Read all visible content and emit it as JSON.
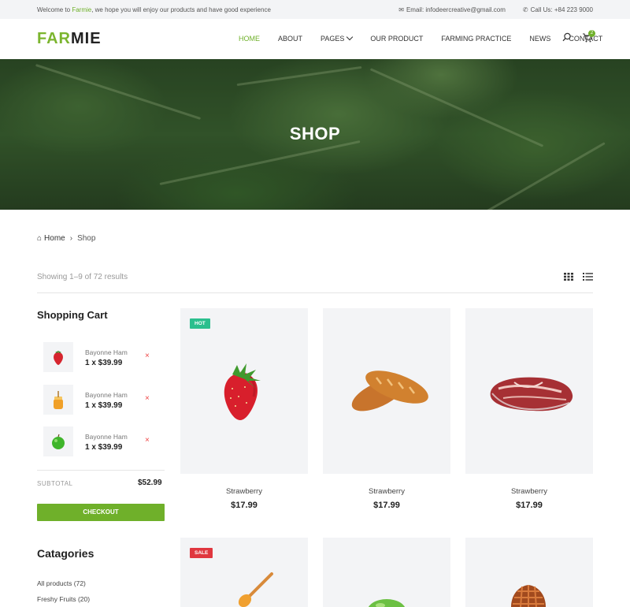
{
  "topbar": {
    "welcome_prefix": "Welcome to ",
    "welcome_brand": "Farmie",
    "welcome_suffix": ", we hope you will enjoy our products and have good experience",
    "email": "Email: infodeercreative@gmail.com",
    "phone": "Call Us: +84 223 9000"
  },
  "header": {
    "logo_far": "FAR",
    "logo_mie": "MIE",
    "nav": [
      {
        "label": "HOME"
      },
      {
        "label": "ABOUT"
      },
      {
        "label": "PAGES"
      },
      {
        "label": "OUR PRODUCT"
      },
      {
        "label": "FARMING PRACTICE"
      },
      {
        "label": "NEWS"
      },
      {
        "label": "CONTACT"
      }
    ],
    "cart_count": "2"
  },
  "hero": {
    "title": "SHOP"
  },
  "breadcrumb": {
    "home": "Home",
    "current": "Shop"
  },
  "results": {
    "text": "Showing 1–9 of 72 results"
  },
  "sidebar": {
    "cart_title": "Shopping Cart",
    "cart_items": [
      {
        "name": "Bayonne Ham",
        "price": "1 x $39.99",
        "icon": "strawberry-icon"
      },
      {
        "name": "Bayonne Ham",
        "price": "1 x $39.99",
        "icon": "honey-icon"
      },
      {
        "name": "Bayonne Ham",
        "price": "1 x $39.99",
        "icon": "apple-icon"
      }
    ],
    "remove_glyph": "×",
    "subtotal_label": "SUBTOTAL",
    "subtotal_value": "$52.99",
    "checkout_label": "CHECKOUT",
    "categories_title": "Catagories",
    "categories": [
      {
        "label": "All products (72)"
      },
      {
        "label": "Freshy Fruits (20)"
      }
    ]
  },
  "products": [
    {
      "name": "Strawberry",
      "price": "$17.99",
      "badge": "HOT",
      "badge_color": "#2bbf8e",
      "icon": "strawberry-image"
    },
    {
      "name": "Strawberry",
      "price": "$17.99",
      "badge": "",
      "icon": "bread-image"
    },
    {
      "name": "Strawberry",
      "price": "$17.99",
      "badge": "",
      "icon": "meat-image"
    },
    {
      "name": "",
      "price": "",
      "badge": "SALE",
      "badge_color": "#e0373f",
      "icon": "honey-dipper-image"
    },
    {
      "name": "",
      "price": "",
      "badge": "",
      "icon": "apple-image"
    },
    {
      "name": "",
      "price": "",
      "badge": "",
      "icon": "waffle-image"
    }
  ],
  "colors": {
    "accent": "#6fb02a",
    "hot": "#2bbf8e",
    "sale": "#e0373f"
  }
}
